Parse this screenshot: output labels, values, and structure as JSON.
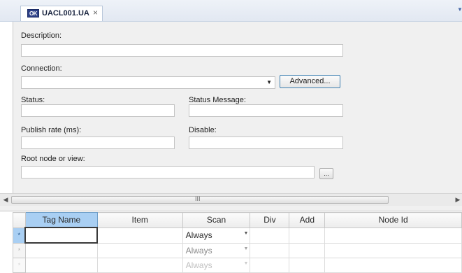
{
  "tab": {
    "icon": "ua-config-icon",
    "icon_text": "OK",
    "title": "UACL001.UA",
    "close": "×"
  },
  "form": {
    "description": {
      "label": "Description:",
      "value": ""
    },
    "connection": {
      "label": "Connection:",
      "value": "",
      "advanced_label": "Advanced..."
    },
    "status": {
      "label": "Status:",
      "value": ""
    },
    "status_message": {
      "label": "Status Message:",
      "value": ""
    },
    "publish_rate": {
      "label": "Publish rate (ms):",
      "value": ""
    },
    "disable": {
      "label": "Disable:",
      "value": ""
    },
    "root_node": {
      "label": "Root node or view:",
      "value": "",
      "browse_label": "..."
    }
  },
  "scrollbar": {
    "grip": "III"
  },
  "grid": {
    "columns": [
      "Tag Name",
      "Item",
      "Scan",
      "Div",
      "Add",
      "Node Id"
    ],
    "selected_column": "Tag Name",
    "rows": [
      {
        "marker": "*",
        "tag_name": "",
        "item": "",
        "scan": "Always",
        "div": "",
        "add": "",
        "node_id": ""
      },
      {
        "marker": "*",
        "tag_name": "",
        "item": "",
        "scan": "Always",
        "div": "",
        "add": "",
        "node_id": ""
      },
      {
        "marker": "*",
        "tag_name": "",
        "item": "",
        "scan": "Always",
        "div": "",
        "add": "",
        "node_id": ""
      }
    ]
  }
}
